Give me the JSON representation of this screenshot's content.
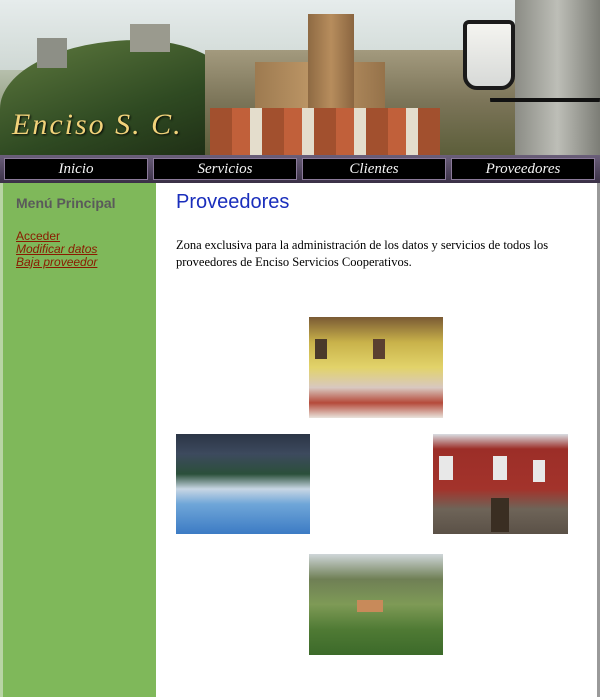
{
  "header": {
    "logo_text": "Enciso S. C."
  },
  "nav": {
    "items": [
      {
        "label": "Inicio"
      },
      {
        "label": "Servicios"
      },
      {
        "label": "Clientes"
      },
      {
        "label": "Proveedores"
      }
    ]
  },
  "sidebar": {
    "title": "Menú Principal",
    "links": [
      {
        "label": "Acceder"
      },
      {
        "label": "Modificar datos"
      },
      {
        "label": "Baja proveedor"
      }
    ]
  },
  "main": {
    "title": "Proveedores",
    "intro": "Zona exclusiva para la administración de los datos y servicios de todos los proveedores de Enciso Servicios Cooperativos."
  },
  "colors": {
    "sidebar_bg": "#7fb85a",
    "title_blue": "#1a2ebc",
    "link_color": "#8a1a00",
    "nav_bg": "#000000"
  }
}
